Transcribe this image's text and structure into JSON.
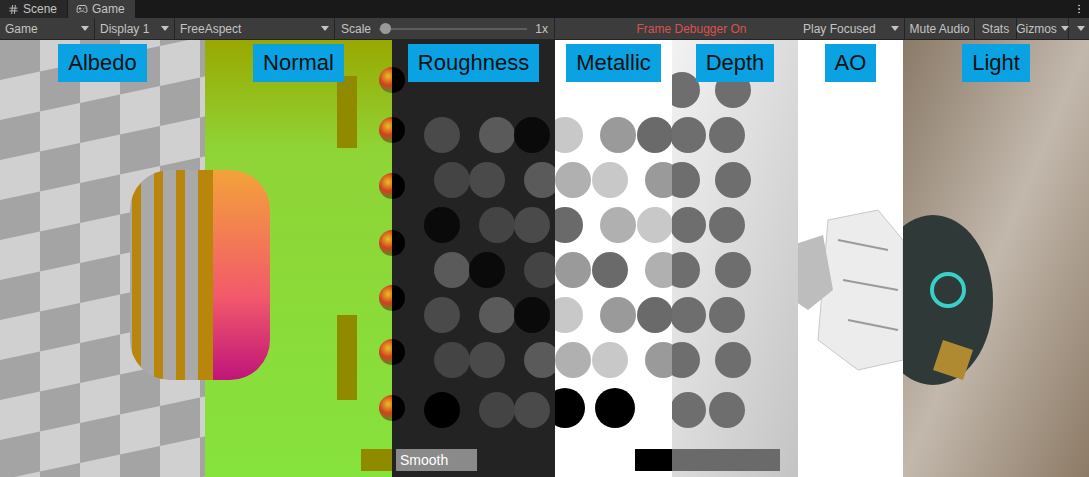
{
  "editor_tabs": [
    {
      "label": "Scene",
      "selected": false
    },
    {
      "label": "Game",
      "selected": true
    }
  ],
  "toolbar": {
    "view": "Game",
    "display": "Display 1",
    "aspect": "FreeAspect",
    "scale": {
      "label": "Scale",
      "level": 0.02,
      "reading": "1x"
    },
    "status": "Frame Debugger On",
    "play_mode": "Play Focused",
    "toggles": [
      {
        "label": "Mute Audio",
        "kind": "button",
        "on": false
      },
      {
        "label": "Stats",
        "kind": "button",
        "on": false
      },
      {
        "label": "Gizmos",
        "kind": "dropdown",
        "on": false
      }
    ]
  },
  "game_view": {
    "panels": [
      {
        "label": "Albedo",
        "kind": "albedo"
      },
      {
        "label": "Normal",
        "kind": "normal"
      },
      {
        "label": "Roughness",
        "kind": "roughness"
      },
      {
        "label": "Metallic",
        "kind": "metallic"
      },
      {
        "label": "Depth",
        "kind": "depth"
      },
      {
        "label": "AO",
        "kind": "ao"
      },
      {
        "label": "Light",
        "kind": "light"
      }
    ],
    "smooth_button": "Smooth"
  }
}
